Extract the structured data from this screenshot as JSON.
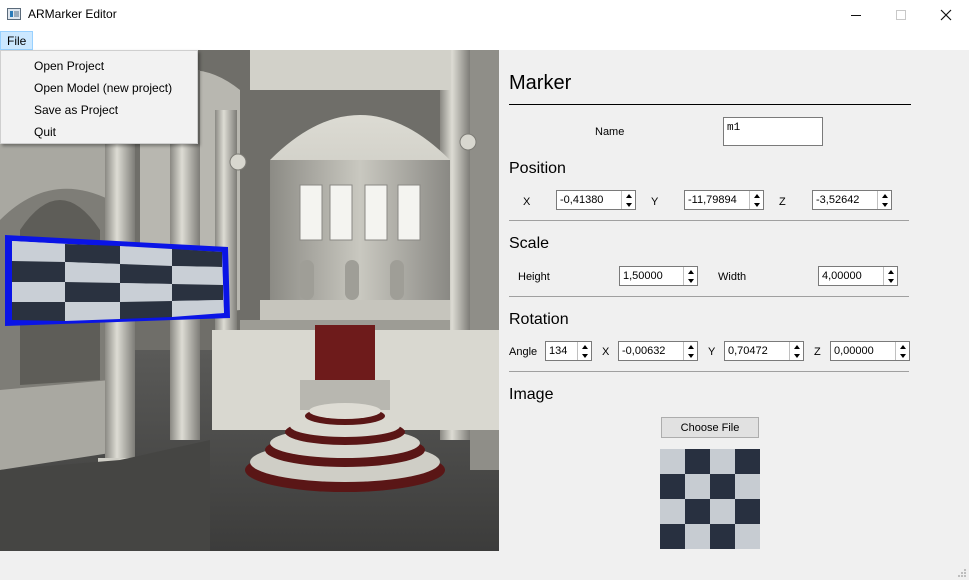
{
  "window": {
    "title": "ARMarker Editor",
    "icon": "app-icon"
  },
  "menubar": {
    "file": "File"
  },
  "file_menu": {
    "items": [
      "Open Project",
      "Open Model (new project)",
      "Save as Project",
      "Quit"
    ]
  },
  "panel": {
    "marker_title": "Marker",
    "name_label": "Name",
    "name_value": "m1",
    "position": {
      "title": "Position",
      "x_label": "X",
      "x_value": "-0,41380",
      "y_label": "Y",
      "y_value": "-11,79894",
      "z_label": "Z",
      "z_value": "-3,52642"
    },
    "scale": {
      "title": "Scale",
      "height_label": "Height",
      "height_value": "1,50000",
      "width_label": "Width",
      "width_value": "4,00000"
    },
    "rotation": {
      "title": "Rotation",
      "angle_label": "Angle",
      "angle_value": "134",
      "x_label": "X",
      "x_value": "-0,00632",
      "y_label": "Y",
      "y_value": "0,70472",
      "z_label": "Z",
      "z_value": "0,00000"
    },
    "image": {
      "title": "Image",
      "choose_file": "Choose File"
    }
  },
  "colors": {
    "marker_outline": "#0a14e6",
    "menu_highlight": "#cce8ff"
  }
}
